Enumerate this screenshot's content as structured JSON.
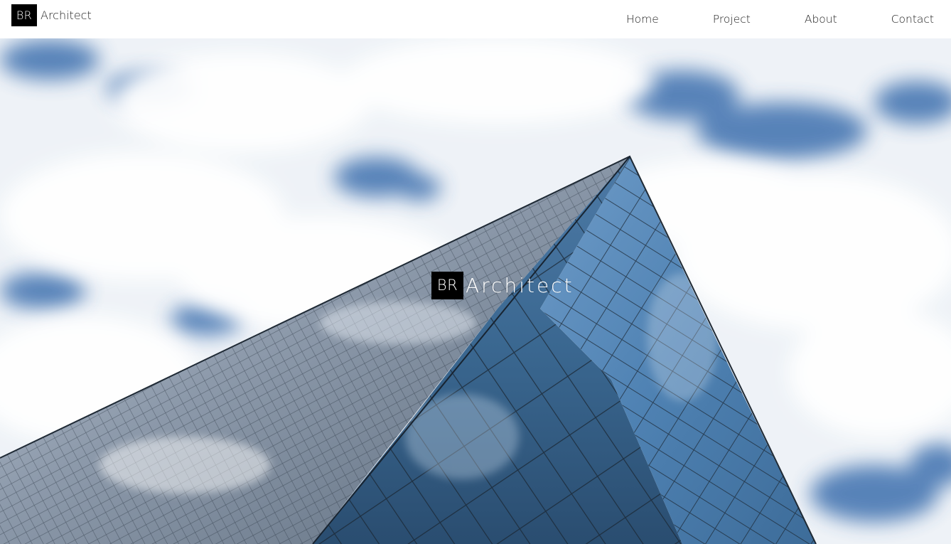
{
  "header": {
    "brand_initials": "BR",
    "brand_name": "Architect",
    "nav": [
      {
        "label": "Home"
      },
      {
        "label": "Project"
      },
      {
        "label": "About"
      },
      {
        "label": "Contact"
      }
    ]
  },
  "hero": {
    "brand_initials": "BR",
    "brand_name": "Architect",
    "image": "glass-skyscraper-against-cloudy-sky"
  },
  "colors": {
    "brand_box": "#000000",
    "nav_text": "#222222",
    "sky_blue": "#3f72b0",
    "cloud": "#f3f5f8",
    "glass_dark": "#1f3d5c"
  }
}
